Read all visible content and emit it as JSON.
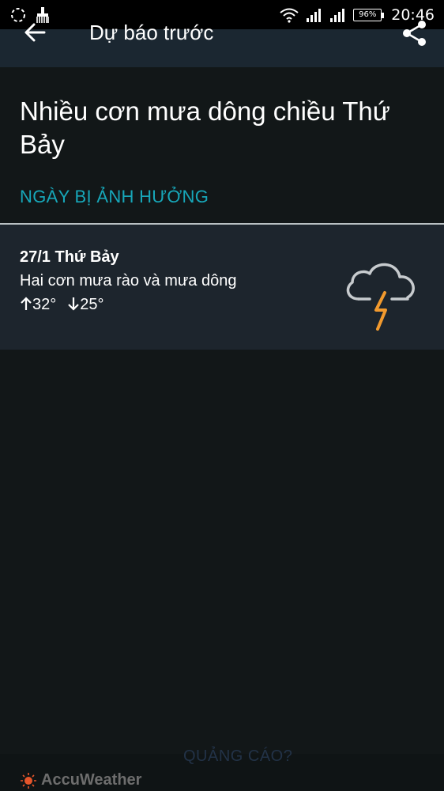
{
  "status_bar": {
    "battery": "96%",
    "time": "20:46"
  },
  "app_bar": {
    "title": "Dự báo trước"
  },
  "alert": {
    "heading": "Nhiều cơn mưa dông chiều Thứ Bảy",
    "affected_label": "NGÀY BỊ ẢNH HƯỞNG"
  },
  "days": [
    {
      "date": "27/1 Thứ Bảy",
      "description": "Hai cơn mưa rào và mưa dông",
      "high": "32°",
      "low": "25°",
      "icon": "thunderstorm-icon"
    }
  ],
  "footer": {
    "ad_label": "QUẢNG CÁO?",
    "brand": "AccuWeather"
  },
  "colors": {
    "background": "#121718",
    "accent": "#17a7b9",
    "card": "#1d252d",
    "bolt": "#f29a2e"
  }
}
